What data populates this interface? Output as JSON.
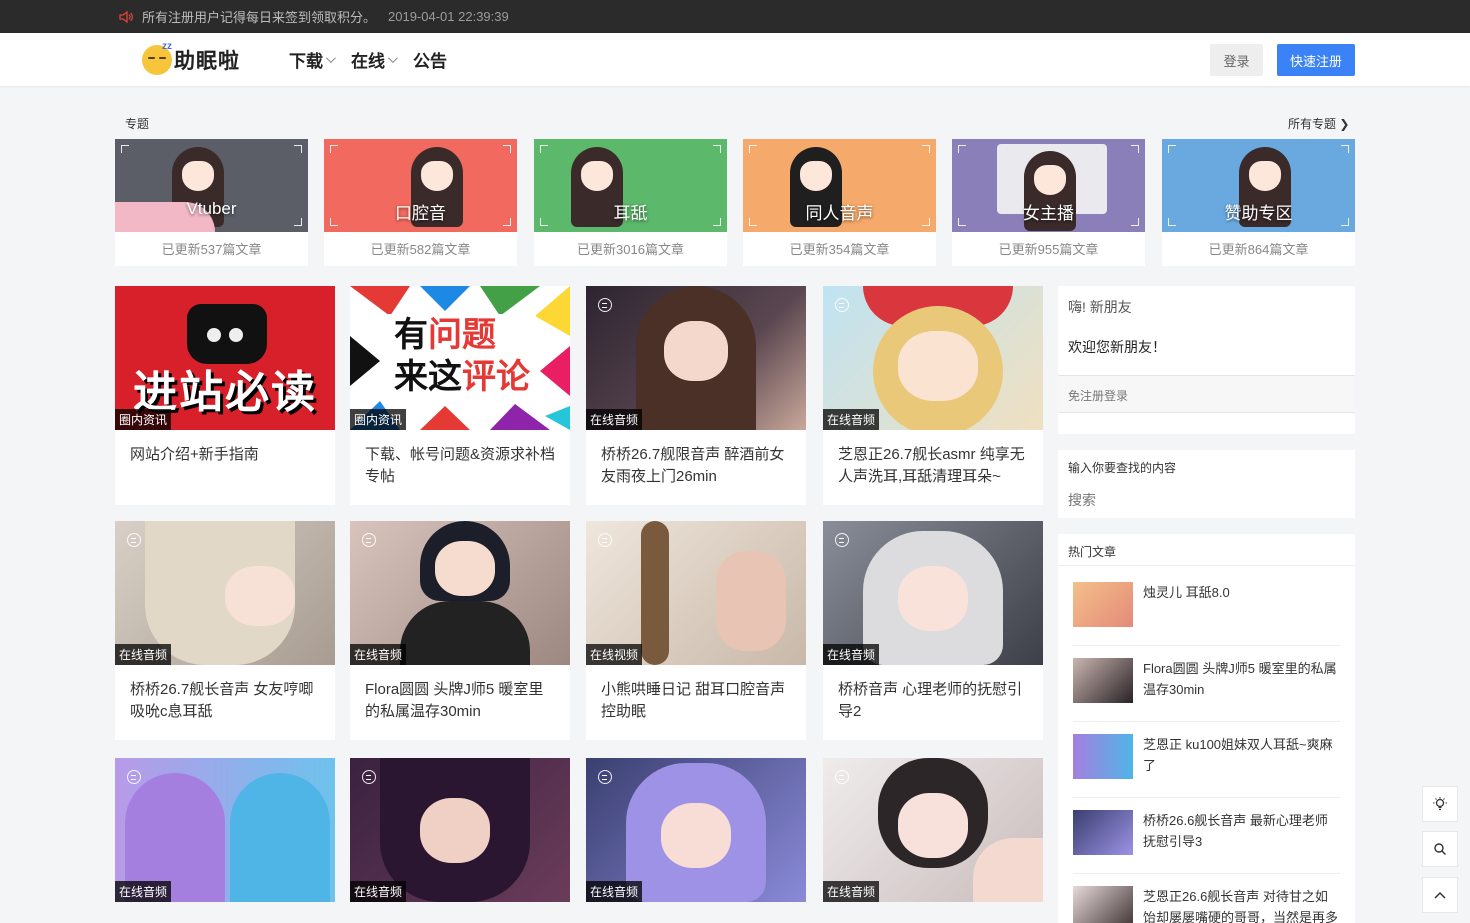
{
  "notice": {
    "text": "所有注册用户记得每日来签到领取积分。",
    "date": "2019-04-01 22:39:39"
  },
  "header": {
    "logo_text": "助眠啦",
    "logo_zz": "zz",
    "nav": [
      {
        "label": "下载",
        "dropdown": true
      },
      {
        "label": "在线",
        "dropdown": true
      },
      {
        "label": "公告",
        "dropdown": false
      }
    ],
    "login_label": "登录",
    "register_label": "快速注册"
  },
  "topics": {
    "title": "专题",
    "more": "所有专题 ❯",
    "items": [
      {
        "name": "Vtuber",
        "count": "已更新537篇文章",
        "color": "#5b5e66"
      },
      {
        "name": "口腔音",
        "count": "已更新582篇文章",
        "color": "#f26a5f"
      },
      {
        "name": "耳舐",
        "count": "已更新3016篇文章",
        "color": "#5cb86a"
      },
      {
        "name": "同人音声",
        "count": "已更新354篇文章",
        "color": "#f5a96a"
      },
      {
        "name": "女主播",
        "count": "已更新955篇文章",
        "color": "#8a7fb8"
      },
      {
        "name": "赞助专区",
        "count": "已更新864篇文章",
        "color": "#6aa9df"
      }
    ]
  },
  "posts": [
    {
      "category": "圈内资讯",
      "title": "网站介绍+新手指南",
      "thumb": "进站必读"
    },
    {
      "category": "圈内资讯",
      "title": "下载、帐号问题&资源求补档专帖",
      "thumb_a": "有",
      "thumb_b": "问题",
      "thumb_c": "来这",
      "thumb_d": "评论"
    },
    {
      "category": "在线音频",
      "title": "桥桥26.7舰限音声 醉酒前女友雨夜上门26min",
      "tone": "#3a2e3a"
    },
    {
      "category": "在线音频",
      "title": "芝恩正26.7舰长asmr 纯享无人声洗耳,耳舐清理耳朵~",
      "tone": "#d9b46a"
    },
    {
      "category": "在线音频",
      "title": "桥桥26.7舰长音声 女友哼唧吸吮c息耳舐",
      "tone": "#c9c3bd"
    },
    {
      "category": "在线音频",
      "title": "Flora圆圆 头牌J师5 暖室里的私属温存30min",
      "tone": "#b8a6a0"
    },
    {
      "category": "在线视频",
      "title": "小熊哄睡日记 甜耳口腔音声控助眠",
      "tone": "#d7cfc6"
    },
    {
      "category": "在线音频",
      "title": "桥桥音声 心理老师的抚慰引导2",
      "tone": "#6a6f78"
    },
    {
      "category": "在线音频",
      "title": "",
      "tone": "#8d78c9"
    },
    {
      "category": "在线音频",
      "title": "",
      "tone": "#4b2d52"
    },
    {
      "category": "在线音频",
      "title": "",
      "tone": "#5a5fa6"
    },
    {
      "category": "在线音频",
      "title": "",
      "tone": "#d6cfcf"
    }
  ],
  "sidebar": {
    "greeting": "嗨! 新朋友",
    "welcome": "欢迎您新朋友！",
    "free_login": "免注册登录",
    "search_title": "输入你要查找的内容",
    "search_placeholder": "搜索",
    "hot_title": "热门文章",
    "hot": [
      {
        "title": "烛灵儿 耳舐8.0",
        "tone": "#e6a56a"
      },
      {
        "title": "Flora圆圆 头牌J师5 暖室里的私属温存30min",
        "tone": "#3b3035"
      },
      {
        "title": "芝恩正 ku100姐妹双人耳舐~爽麻了",
        "tone": "#7b7fd8"
      },
      {
        "title": "桥桥26.6舰长音声 最新心理老师抚慰引导3",
        "tone": "#6f7fc9"
      },
      {
        "title": "芝恩正26.6舰长音声 对待甘之如饴却屡屡嘴硬的哥哥，当然是再多",
        "tone": "#4a3a3a"
      }
    ]
  }
}
